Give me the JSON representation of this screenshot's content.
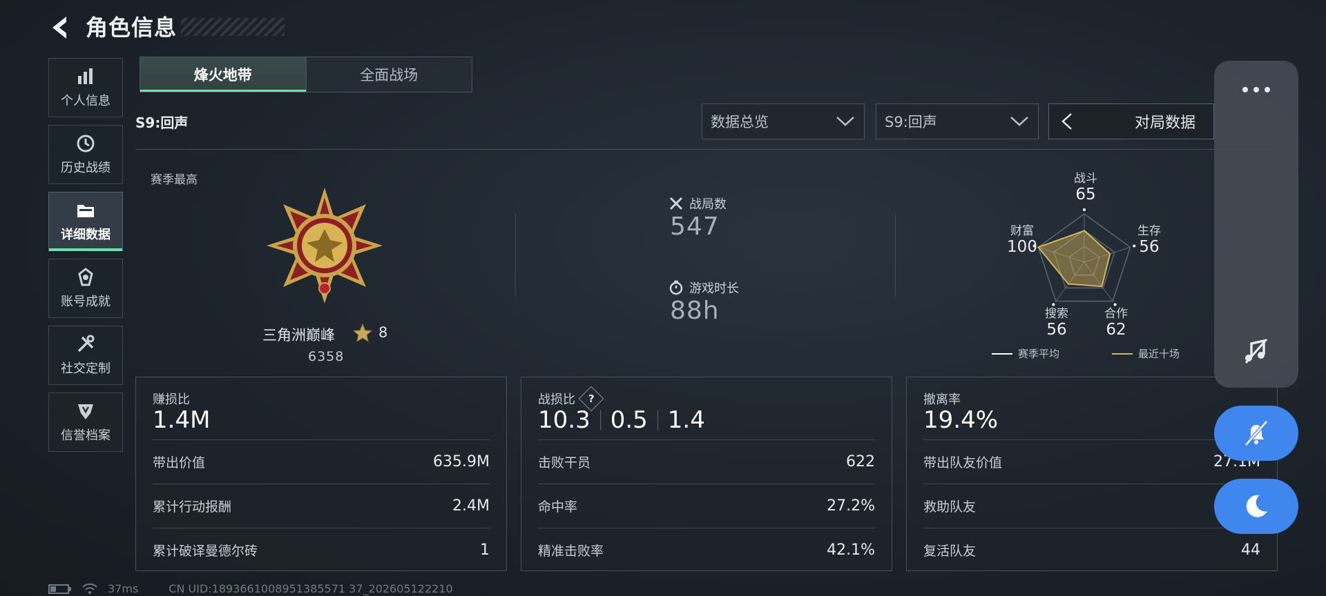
{
  "header": {
    "title": "角色信息"
  },
  "sidebar": {
    "items": [
      {
        "label": "个人信息",
        "icon": "bar-chart-icon"
      },
      {
        "label": "历史战绩",
        "icon": "history-clock-icon"
      },
      {
        "label": "详细数据",
        "icon": "folder-icon",
        "active": true
      },
      {
        "label": "账号成就",
        "icon": "achievement-icon"
      },
      {
        "label": "社交定制",
        "icon": "tools-icon"
      },
      {
        "label": "信誉档案",
        "icon": "shield-icon"
      }
    ]
  },
  "mode_tabs": [
    {
      "label": "烽火地带",
      "active": true
    },
    {
      "label": "全面战场",
      "active": false
    }
  ],
  "season_label": "S9:回声",
  "filters": {
    "overview": "数据总览",
    "season": "S9:回声",
    "match_data": "对局数据"
  },
  "season_best": {
    "label": "赛季最高",
    "rank_name": "三角洲巅峰",
    "stars": "8",
    "score": "6358"
  },
  "summary": {
    "matches_label": "战局数",
    "matches_value": "547",
    "playtime_label": "游戏时长",
    "playtime_value": "88h"
  },
  "radar": {
    "axes": [
      {
        "label": "战斗",
        "value": "65"
      },
      {
        "label": "生存",
        "value": "56"
      },
      {
        "label": "合作",
        "value": "62"
      },
      {
        "label": "搜索",
        "value": "56"
      },
      {
        "label": "财富",
        "value": "100"
      }
    ],
    "legend_season": "赛季平均",
    "legend_recent": "最近十场",
    "colors": {
      "recent": "#d7b659",
      "season": "#ffffff"
    }
  },
  "cards": {
    "profit": {
      "title": "赚损比",
      "big": "1.4M",
      "rows": [
        {
          "label": "带出价值",
          "value": "635.9M"
        },
        {
          "label": "累计行动报酬",
          "value": "2.4M"
        },
        {
          "label": "累计破译曼德尔砖",
          "value": "1"
        }
      ]
    },
    "combat": {
      "title": "战损比",
      "help": "?",
      "big_parts": [
        "10.3",
        "0.5",
        "1.4"
      ],
      "rows": [
        {
          "label": "击败干员",
          "value": "622"
        },
        {
          "label": "命中率",
          "value": "27.2%"
        },
        {
          "label": "精准击败率",
          "value": "42.1%"
        }
      ]
    },
    "extract": {
      "title": "撤离率",
      "big": "19.4%",
      "rows": [
        {
          "label": "带出队友价值",
          "value": "27.1M"
        },
        {
          "label": "救助队友",
          "value": ""
        },
        {
          "label": "复活队友",
          "value": "44"
        }
      ]
    }
  },
  "footer": {
    "ping": "37ms",
    "uid": "CN UID:1893661008951385571 37_202605122210"
  },
  "accent_color": "#6fe0a8",
  "float_button_color": "#3f86ee"
}
